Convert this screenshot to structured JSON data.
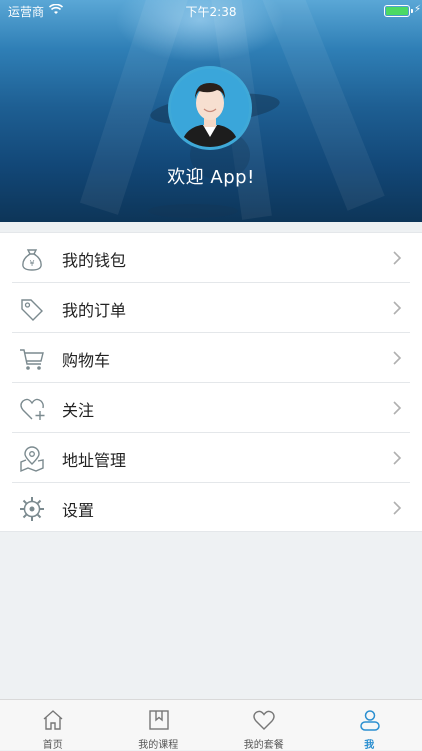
{
  "status_bar": {
    "carrier": "运营商",
    "time": "下午2:38",
    "battery_color": "#4cd964"
  },
  "header": {
    "welcome": "欢迎 App!",
    "avatar_icon": "user-avatar"
  },
  "menu": {
    "items": [
      {
        "label": "我的钱包",
        "icon": "wallet-icon"
      },
      {
        "label": "我的订单",
        "icon": "tag-icon"
      },
      {
        "label": "购物车",
        "icon": "cart-icon"
      },
      {
        "label": "关注",
        "icon": "heart-plus-icon"
      },
      {
        "label": "地址管理",
        "icon": "map-pin-icon"
      },
      {
        "label": "设置",
        "icon": "gear-icon"
      }
    ]
  },
  "tabbar": {
    "tabs": [
      {
        "label": "首页",
        "icon": "home-icon",
        "active": false
      },
      {
        "label": "我的课程",
        "icon": "bookmark-icon",
        "active": false
      },
      {
        "label": "我的套餐",
        "icon": "heart-icon",
        "active": false
      },
      {
        "label": "我",
        "icon": "user-icon",
        "active": true
      }
    ],
    "active_color": "#2b8fd0"
  }
}
